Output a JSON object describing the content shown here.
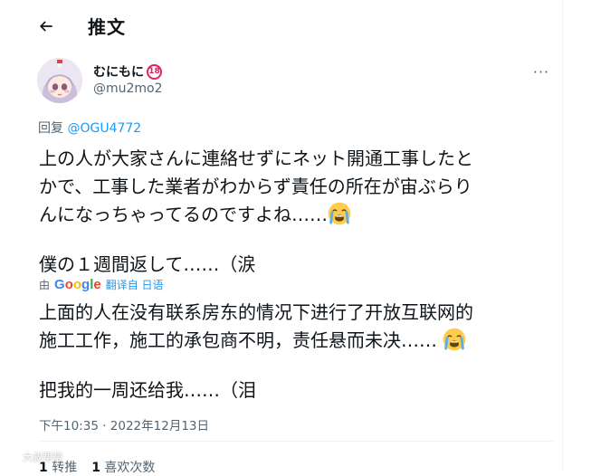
{
  "header": {
    "title": "推文",
    "back_icon": "arrow-left-icon"
  },
  "author": {
    "display_name": "むにもに",
    "age_badge": "18",
    "handle": "@mu2mo2"
  },
  "more_icon": "more-horizontal-icon",
  "more_label": "···",
  "reply": {
    "prefix": "回复 ",
    "to": "@OGU4772"
  },
  "tweet": {
    "line1": "上の人が大家さんに連絡せずにネット開通工事したと",
    "line2": "かで、工事した業者がわからず責任の所在が宙ぶらり",
    "line3": "んになっちゃってるのですよね……",
    "line4": "僕の１週間返して……（涙",
    "emoji_name": "crying-face"
  },
  "translation": {
    "by": "由",
    "provider": "Google",
    "link": "翻译自 日语",
    "line1": "上面的人在没有联系房东的情况下进行了开放互联网的",
    "line2": "施工工作，施工的承包商不明，责任悬而未决……",
    "line3": "把我的一周还给我……（泪"
  },
  "timestamp": "下午10:35 · 2022年12月13日",
  "stats": {
    "retweets_count": "1",
    "retweets_label": "转推",
    "likes_count": "1",
    "likes_label": "喜欢次数"
  },
  "watermark": "大叔帮帮",
  "colors": {
    "accent": "#1d9bf0",
    "secondary_text": "#536471",
    "primary_text": "#0f1419",
    "badge": "#e0245e"
  }
}
